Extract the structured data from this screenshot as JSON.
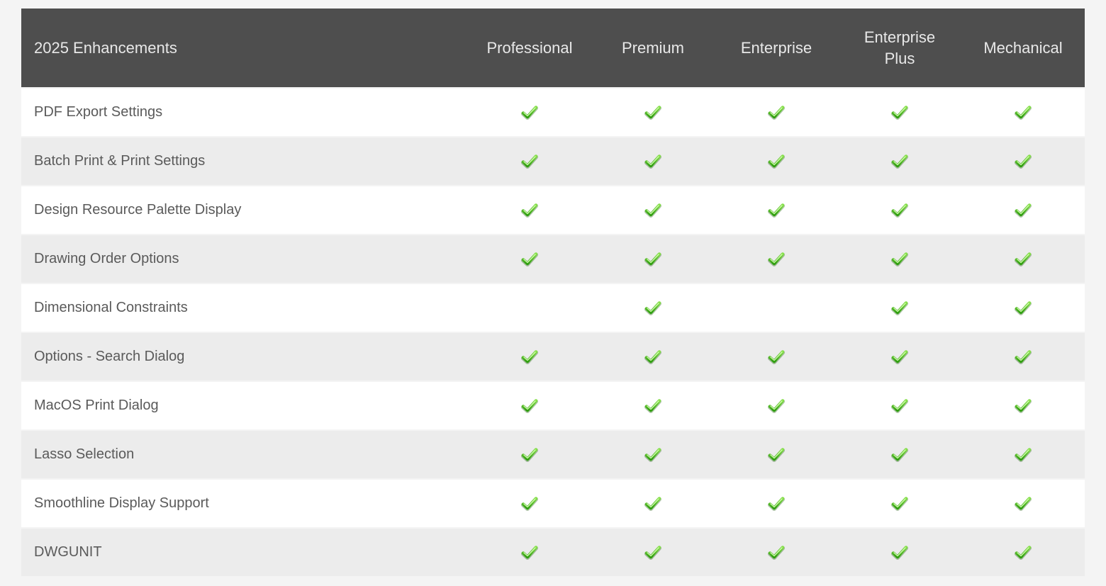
{
  "header": {
    "feature_col": "2025 Enhancements",
    "plans": [
      "Professional",
      "Premium",
      "Enterprise",
      "Enterprise Plus",
      "Mechanical"
    ]
  },
  "features": [
    {
      "name": "PDF Export Settings",
      "checks": [
        true,
        true,
        true,
        true,
        true
      ]
    },
    {
      "name": "Batch Print & Print Settings",
      "checks": [
        true,
        true,
        true,
        true,
        true
      ]
    },
    {
      "name": "Design Resource Palette Display",
      "checks": [
        true,
        true,
        true,
        true,
        true
      ]
    },
    {
      "name": "Drawing Order Options",
      "checks": [
        true,
        true,
        true,
        true,
        true
      ]
    },
    {
      "name": "Dimensional Constraints",
      "checks": [
        false,
        true,
        false,
        true,
        true
      ]
    },
    {
      "name": "Options - Search Dialog",
      "checks": [
        true,
        true,
        true,
        true,
        true
      ]
    },
    {
      "name": "MacOS Print Dialog",
      "checks": [
        true,
        true,
        true,
        true,
        true
      ]
    },
    {
      "name": "Lasso Selection",
      "checks": [
        true,
        true,
        true,
        true,
        true
      ]
    },
    {
      "name": "Smoothline Display Support",
      "checks": [
        true,
        true,
        true,
        true,
        true
      ]
    },
    {
      "name": "DWGUNIT",
      "checks": [
        true,
        true,
        true,
        true,
        true
      ]
    }
  ],
  "icons": {
    "check": "check-icon"
  },
  "colors": {
    "header_bg": "#4e4e4e",
    "row_odd_bg": "#ffffff",
    "row_even_bg": "#ececec",
    "check_green": "#4caf1a"
  }
}
